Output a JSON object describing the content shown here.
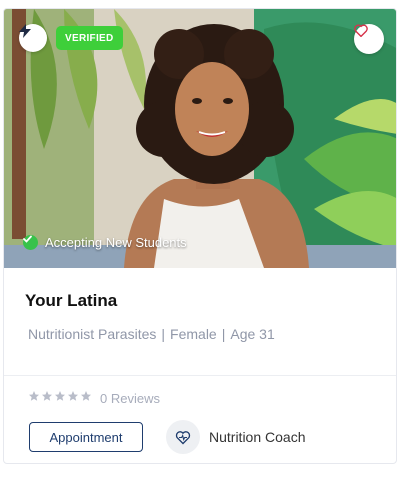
{
  "profile": {
    "verified_label": "VERIFIED",
    "status_text": "Accepting New Students",
    "name": "Your Latina",
    "specialty": "Nutritionist Parasites",
    "gender": "Female",
    "age": "Age 31",
    "separator": "|",
    "rating_stars": 0,
    "rating_max": 5,
    "reviews_text": "0 Reviews",
    "appointment_label": "Appointment",
    "role": "Nutrition Coach"
  },
  "icons": {
    "bolt": "bolt-icon",
    "favorite": "heart-icon",
    "status": "check-circle-icon",
    "role": "heart-pulse-icon"
  },
  "colors": {
    "verified": "#3ecf3a",
    "accent": "#1f3d6e",
    "favorite": "#d6324a",
    "status_ok": "#38c24b",
    "muted": "#9097a8"
  }
}
